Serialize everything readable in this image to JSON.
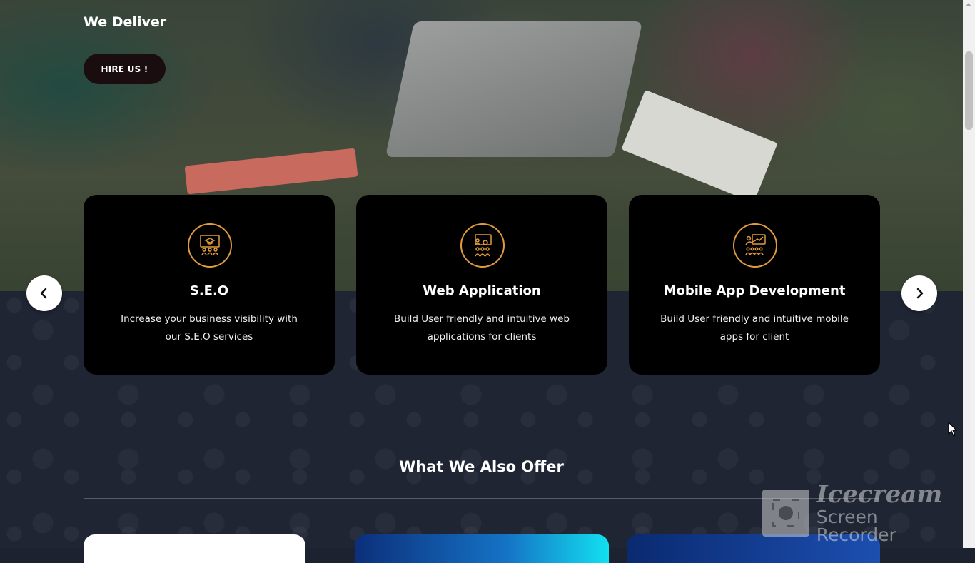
{
  "hero": {
    "tagline": "We Deliver",
    "hire_button": "HIRE US !"
  },
  "services": [
    {
      "icon": "graduation-presentation-icon",
      "title": "S.E.O",
      "description": "Increase your business visibility with our S.E.O services"
    },
    {
      "icon": "classroom-board-icon",
      "title": "Web Application",
      "description": "Build User friendly and intuitive web applications for clients"
    },
    {
      "icon": "teacher-presentation-icon",
      "title": "Mobile App Development",
      "description": "Build User friendly and intuitive mobile apps for client"
    }
  ],
  "carousel": {
    "prev_icon": "chevron-left-icon",
    "next_icon": "chevron-right-icon"
  },
  "offer_section": {
    "title": "What We Also Offer"
  },
  "watermark": {
    "line1": "Icecream",
    "line2": "Screen Recorder"
  },
  "colors": {
    "accent": "#e19a3e",
    "card_bg": "#000000",
    "section_bg": "#1f2533",
    "button_bg": "#1a0d10"
  }
}
